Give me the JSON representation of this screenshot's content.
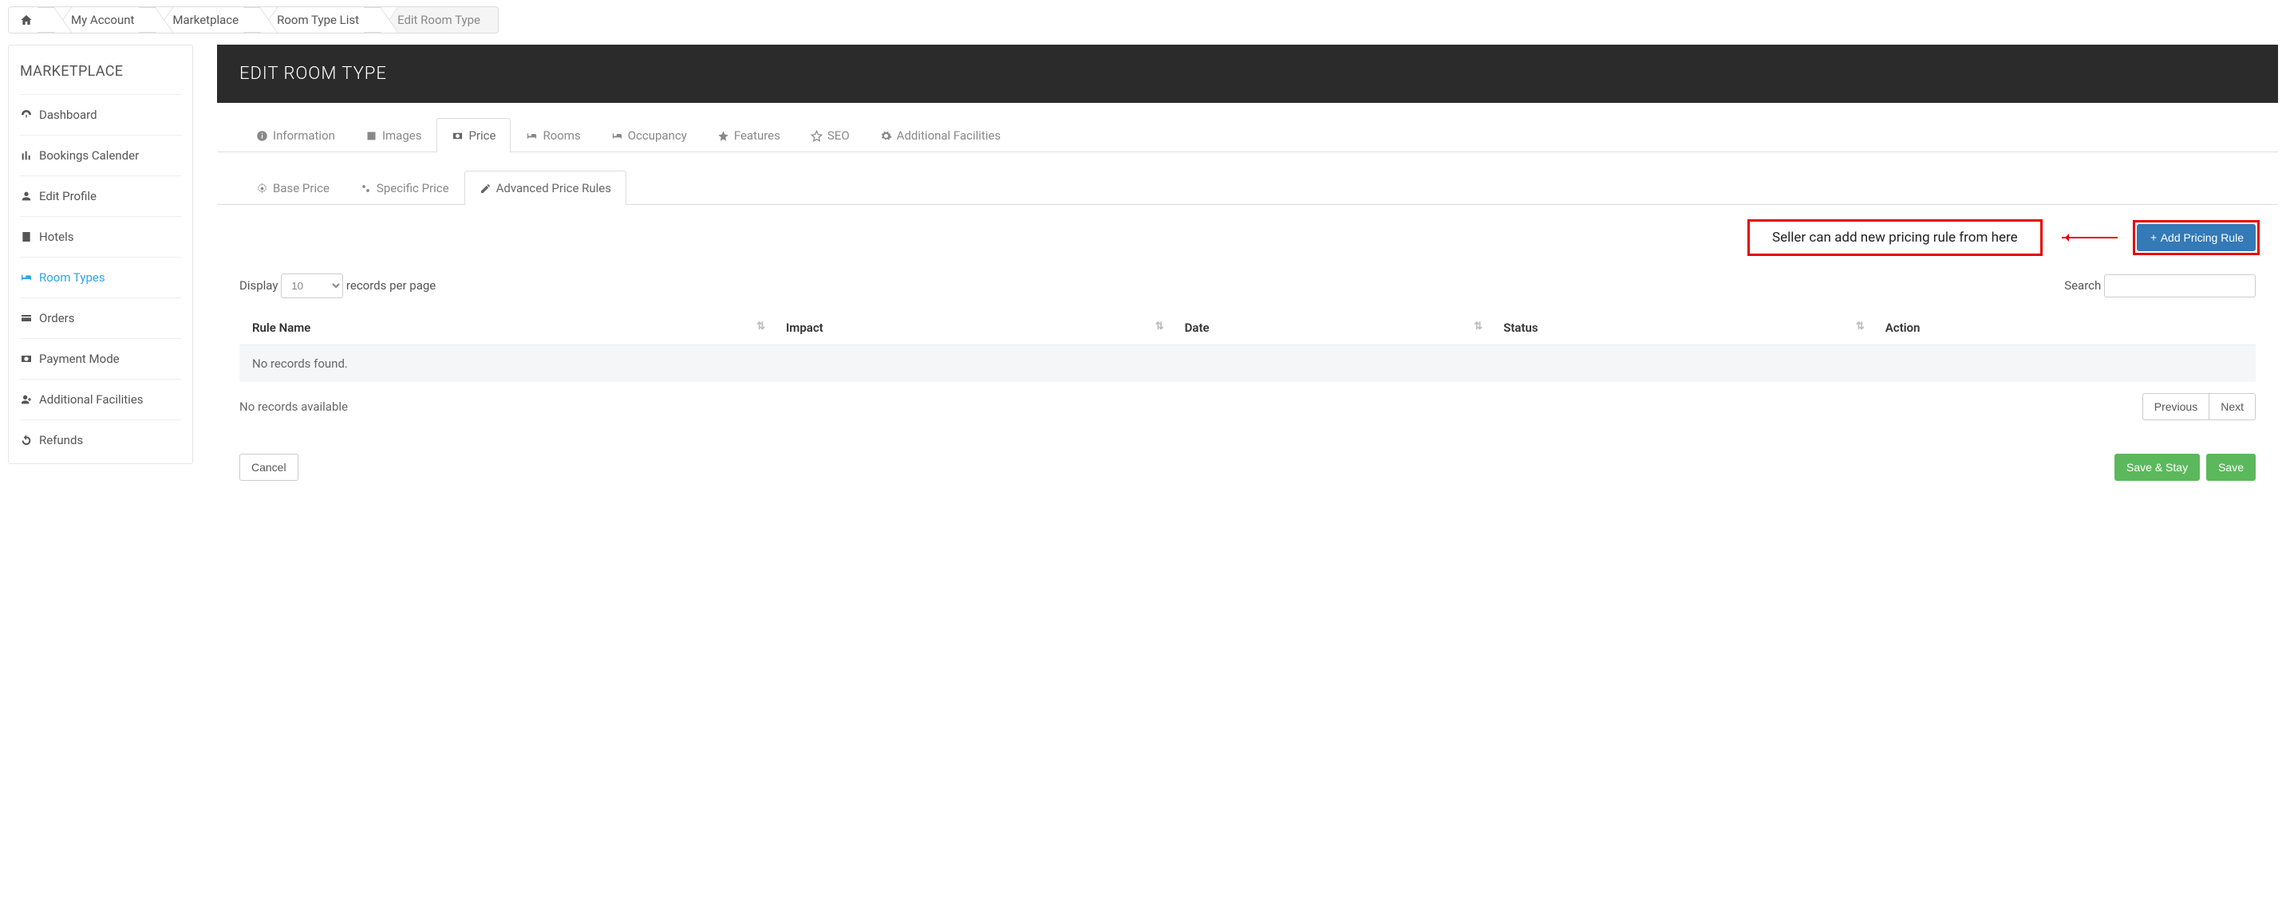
{
  "breadcrumb": {
    "home": "",
    "items": [
      "My Account",
      "Marketplace",
      "Room Type List",
      "Edit Room Type"
    ]
  },
  "sidebar": {
    "title": "MARKETPLACE",
    "items": [
      {
        "label": "Dashboard"
      },
      {
        "label": "Bookings Calender"
      },
      {
        "label": "Edit Profile"
      },
      {
        "label": "Hotels"
      },
      {
        "label": "Room Types"
      },
      {
        "label": "Orders"
      },
      {
        "label": "Payment Mode"
      },
      {
        "label": "Additional Facilities"
      },
      {
        "label": "Refunds"
      }
    ]
  },
  "header": {
    "title": "EDIT ROOM TYPE"
  },
  "tabs": [
    {
      "label": "Information"
    },
    {
      "label": "Images"
    },
    {
      "label": "Price"
    },
    {
      "label": "Rooms"
    },
    {
      "label": "Occupancy"
    },
    {
      "label": "Features"
    },
    {
      "label": "SEO"
    },
    {
      "label": "Additional Facilities"
    }
  ],
  "subtabs": [
    {
      "label": "Base Price"
    },
    {
      "label": "Specific Price"
    },
    {
      "label": "Advanced Price Rules"
    }
  ],
  "callout": {
    "text": "Seller can add new pricing rule from here"
  },
  "buttons": {
    "addRule": "Add Pricing Rule",
    "cancel": "Cancel",
    "saveStay": "Save & Stay",
    "save": "Save",
    "prev": "Previous",
    "next": "Next"
  },
  "table": {
    "displayLabelPre": "Display",
    "displayLabelPost": "records per page",
    "perPageValue": "10",
    "searchLabel": "Search",
    "columns": [
      "Rule Name",
      "Impact",
      "Date",
      "Status",
      "Action"
    ],
    "emptyRow": "No records found.",
    "footerInfo": "No records available"
  }
}
